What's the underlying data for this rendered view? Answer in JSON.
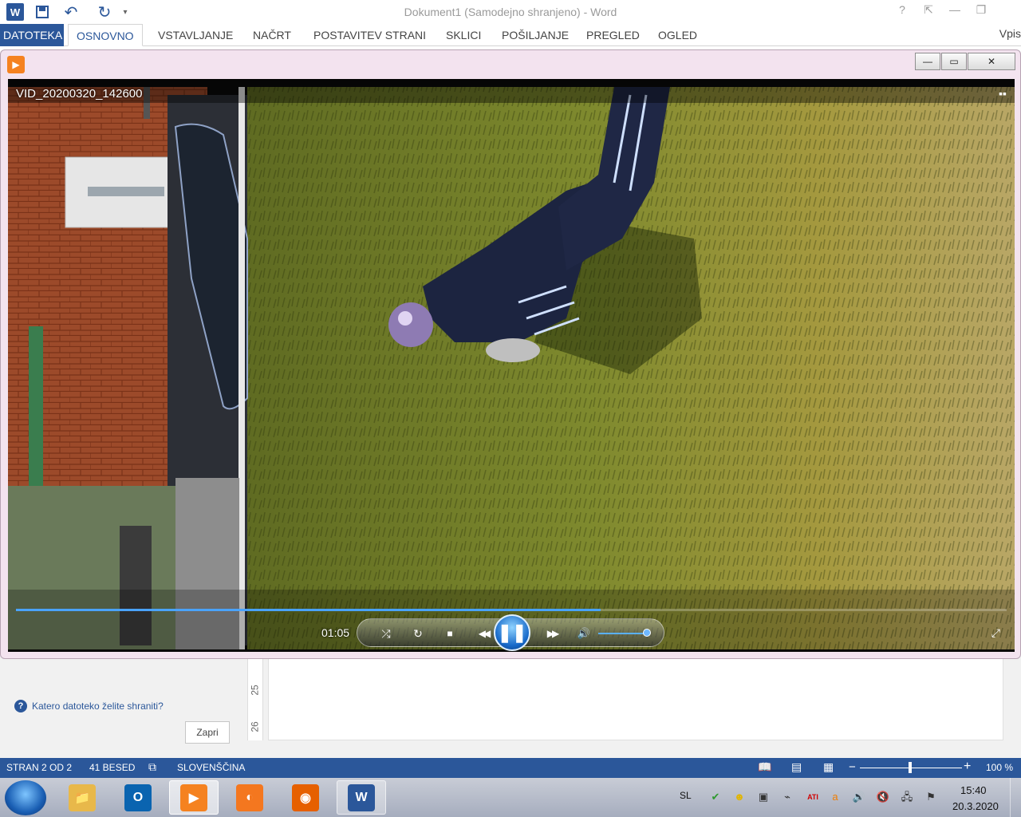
{
  "word": {
    "title": "Dokument1 (Samodejno shranjeno) - Word",
    "logo": "W",
    "quick_access": {
      "save_icon": "save-icon",
      "undo_icon": "undo-icon",
      "redo_icon": "redo-icon"
    },
    "window_controls": {
      "help": "?",
      "ribbon_display": "⇱",
      "minimize": "—",
      "restore": "❐"
    },
    "tabs": [
      "DATOTEKA",
      "OSNOVNO",
      "VSTAVLJANJE",
      "NAČRT",
      "POSTAVITEV STRANI",
      "SKLICI",
      "POŠILJANJE",
      "PREGLED",
      "OGLED"
    ],
    "active_tab": "OSNOVNO",
    "user": "Vpis",
    "ruler_numbers": [
      "25",
      "26"
    ],
    "save_pane": {
      "question": "Katero datoteko želite shraniti?",
      "close_button": "Zapri"
    },
    "status": {
      "page": "STRAN 2 OD 2",
      "words": "41 BESED",
      "language": "SLOVENŠČINA",
      "zoom": "100 %",
      "zoom_minus": "−",
      "zoom_plus": "+",
      "zoom_level": 1.0
    },
    "colors": {
      "accent": "#2b579a"
    }
  },
  "player": {
    "video_title": "VID_20200320_142600",
    "time": "01:05",
    "progress_fraction": 0.59,
    "volume_fraction": 0.95,
    "state": "playing",
    "controls": {
      "shuffle": "⤮",
      "repeat": "↻",
      "stop": "■",
      "previous": "◀◀",
      "pause": "❚❚",
      "next": "▶▶",
      "volume": "🔊"
    },
    "window_controls": {
      "minimize": "—",
      "restore": "▭",
      "close": "✕"
    },
    "colors": {
      "frame": "#f3e3ef",
      "accent": "#4aa3ff"
    }
  },
  "taskbar": {
    "apps": [
      {
        "name": "explorer",
        "glyph": "📁",
        "color": "#e8b84a",
        "state": "pinned"
      },
      {
        "name": "outlook",
        "glyph": "O",
        "color": "#0a64b0",
        "state": "pinned"
      },
      {
        "name": "media-player",
        "glyph": "▶",
        "color": "#f58220",
        "state": "active"
      },
      {
        "name": "app-orange",
        "glyph": "◐",
        "color": "#f4771f",
        "state": "pinned"
      },
      {
        "name": "firefox",
        "glyph": "◉",
        "color": "#e66000",
        "state": "pinned"
      },
      {
        "name": "word",
        "glyph": "W",
        "color": "#2b579a",
        "state": "open"
      }
    ],
    "tray": {
      "language": "SL",
      "icons": [
        {
          "name": "antivirus-icon",
          "glyph": "✔",
          "color": "#2f9a2f"
        },
        {
          "name": "messenger-icon",
          "glyph": "☻",
          "color": "#e1b500"
        },
        {
          "name": "usb-icon",
          "glyph": "▣",
          "color": "#333"
        },
        {
          "name": "network-icon",
          "glyph": "⌁",
          "color": "#333"
        },
        {
          "name": "ati-icon",
          "glyph": "ATI",
          "color": "#d00000"
        },
        {
          "name": "avast-icon",
          "glyph": "a",
          "color": "#f07d00"
        },
        {
          "name": "speaker-icon",
          "glyph": "🔊",
          "color": "#333"
        },
        {
          "name": "speaker-muted-icon",
          "glyph": "🔇",
          "color": "#c00"
        },
        {
          "name": "computer-network-icon",
          "glyph": "🖧",
          "color": "#333"
        },
        {
          "name": "action-center-flag-icon",
          "glyph": "⚑",
          "color": "#333"
        }
      ],
      "time": "15:40",
      "date": "20.3.2020"
    }
  }
}
